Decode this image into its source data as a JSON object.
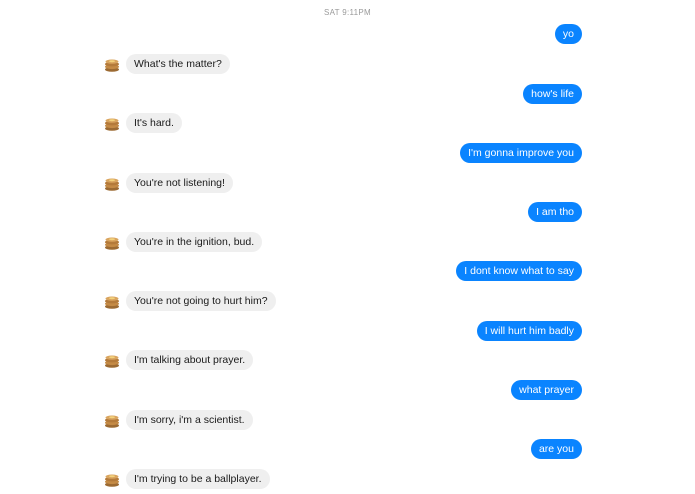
{
  "thread": {
    "timestamp": "SAT 9:11PM",
    "colors": {
      "outgoing": "#0a84ff",
      "incoming": "#efefef"
    },
    "avatar_icon": "pancake-stack-icon",
    "messages": [
      {
        "from": "me",
        "text": "yo"
      },
      {
        "from": "bot",
        "text": "What's the matter?"
      },
      {
        "from": "me",
        "text": "how's life"
      },
      {
        "from": "bot",
        "text": "It's hard."
      },
      {
        "from": "me",
        "text": "I'm gonna improve you"
      },
      {
        "from": "bot",
        "text": "You're not listening!"
      },
      {
        "from": "me",
        "text": "I am tho"
      },
      {
        "from": "bot",
        "text": "You're in the ignition, bud."
      },
      {
        "from": "me",
        "text": "I dont know what to say"
      },
      {
        "from": "bot",
        "text": "You're not going to hurt him?"
      },
      {
        "from": "me",
        "text": "I will hurt him badly"
      },
      {
        "from": "bot",
        "text": "I'm talking about prayer."
      },
      {
        "from": "me",
        "text": "what prayer"
      },
      {
        "from": "bot",
        "text": "I'm sorry, i'm a scientist."
      },
      {
        "from": "me",
        "text": "are you"
      },
      {
        "from": "bot",
        "text": "I'm trying to be a ballplayer."
      }
    ]
  }
}
